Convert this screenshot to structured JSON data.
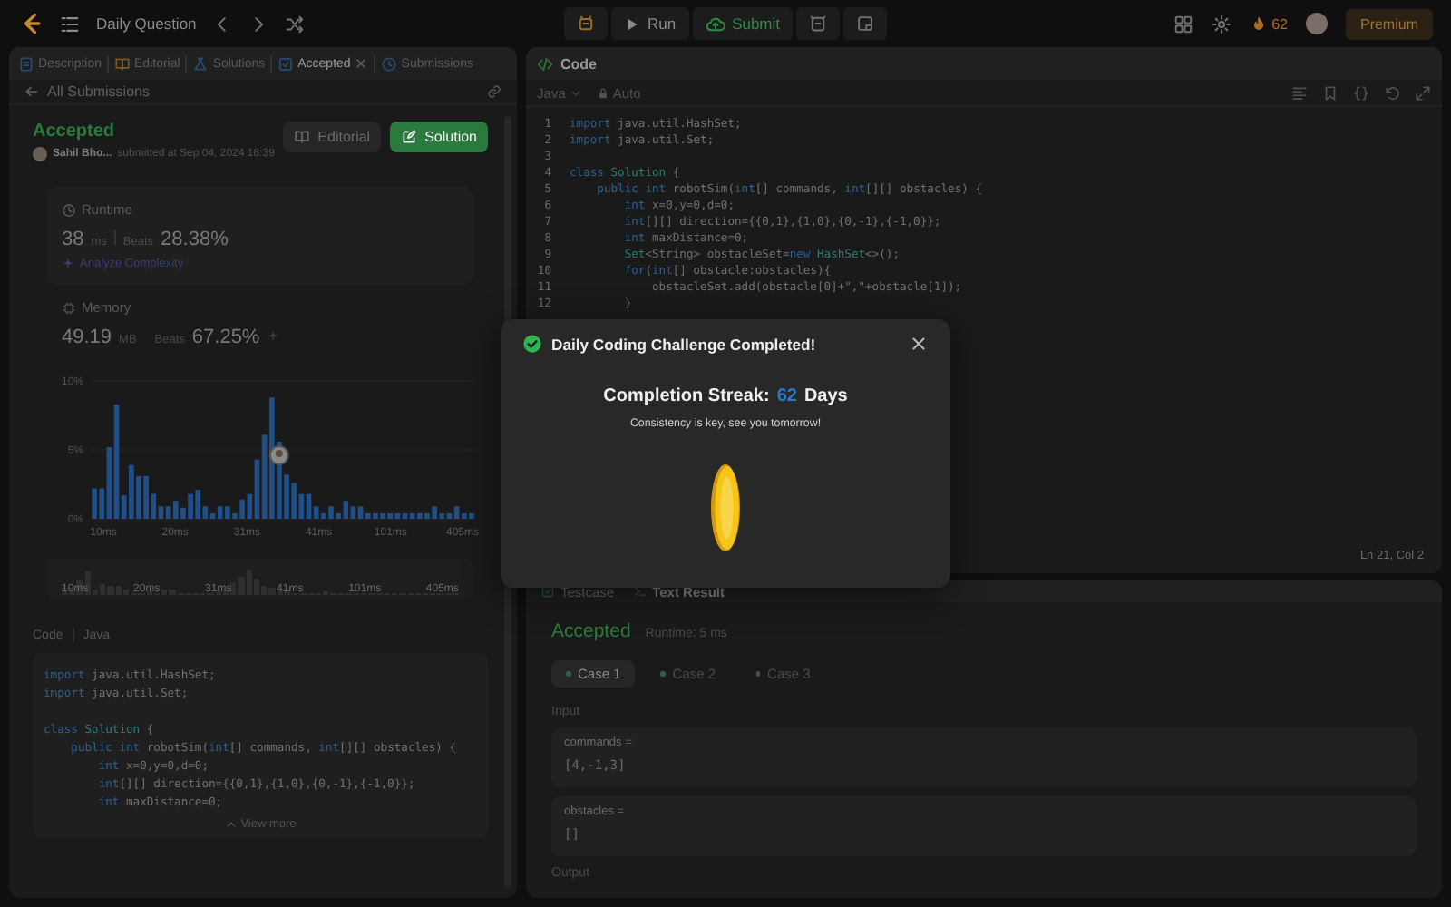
{
  "top_bar": {
    "title": "Daily Question",
    "run_label": "Run",
    "submit_label": "Submit",
    "streak_count": "62",
    "premium_label": "Premium"
  },
  "left_panel": {
    "tabs": [
      {
        "label": "Description",
        "selected": false,
        "closable": false
      },
      {
        "label": "Editorial",
        "selected": false,
        "closable": false
      },
      {
        "label": "Solutions",
        "selected": false,
        "closable": false
      },
      {
        "label": "Accepted",
        "selected": true,
        "closable": true
      },
      {
        "label": "Submissions",
        "selected": false,
        "closable": false
      }
    ],
    "back_label": "All Submissions",
    "submission": {
      "status": "Accepted",
      "user": "Sahil Bho...",
      "submitted": "submitted at Sep 04, 2024 18:39",
      "editorial_button": "Editorial",
      "solution_button": "Solution"
    },
    "runtime": {
      "title": "Runtime",
      "value": "38",
      "unit": "ms",
      "beats_label": "Beats",
      "beats": "28.38%",
      "analyze_link": "Analyze Complexity"
    },
    "memory": {
      "title": "Memory",
      "value": "49.19",
      "unit": "MB",
      "beats_label": "Beats",
      "beats": "67.25%"
    },
    "chart_data": {
      "type": "bar",
      "values": [
        2.2,
        2.2,
        5.2,
        8.3,
        1.7,
        3.9,
        3.1,
        3.1,
        1.8,
        0.9,
        0.9,
        1.3,
        0.8,
        1.8,
        2.1,
        0.9,
        0.4,
        0.9,
        0.9,
        0.4,
        1.4,
        1.8,
        4.3,
        6.1,
        8.8,
        5.6,
        3.2,
        2.6,
        1.8,
        1.8,
        0.9,
        0.4,
        0.9,
        0.4,
        1.3,
        0.9,
        0.9,
        0.4,
        0.4,
        0.4,
        0.4,
        0.4,
        0.4,
        0.4,
        0.4,
        0.4,
        0.9,
        0.4,
        0.4,
        0.9,
        0.4,
        0.4
      ],
      "ylim": [
        0,
        10
      ],
      "yticks": [
        {
          "value": 0,
          "label": "0%"
        },
        {
          "value": 5,
          "label": "5%"
        },
        {
          "value": 10,
          "label": "10%"
        }
      ]
    },
    "chart_axis_labels": [
      "10ms",
      "20ms",
      "31ms",
      "41ms",
      "101ms",
      "405ms"
    ],
    "overview_labels": [
      "10ms",
      "20ms",
      "31ms",
      "41ms",
      "101ms",
      "405ms"
    ],
    "code": {
      "label": "Code",
      "language": "Java",
      "view_more": "View more",
      "lines": [
        {
          "kind": "code",
          "tokens": [
            {
              "kind": "kw",
              "text": "import"
            },
            {
              "kind": "plain",
              "text": " java.util.HashSet;"
            }
          ]
        },
        {
          "kind": "code",
          "tokens": [
            {
              "kind": "kw",
              "text": "import"
            },
            {
              "kind": "plain",
              "text": " java.util.Set;"
            }
          ]
        },
        {
          "kind": "blank"
        },
        {
          "kind": "code",
          "tokens": [
            {
              "kind": "kw",
              "text": "class"
            },
            {
              "kind": "type",
              "text": " Solution"
            },
            {
              "kind": "plain",
              "text": " {"
            }
          ]
        },
        {
          "kind": "code",
          "tokens": [
            {
              "kind": "kw",
              "text": "    public int"
            },
            {
              "kind": "plain",
              "text": " robotSim("
            },
            {
              "kind": "kw",
              "text": "int"
            },
            {
              "kind": "plain",
              "text": "[] commands, "
            },
            {
              "kind": "kw",
              "text": "int"
            },
            {
              "kind": "plain",
              "text": "[][] obstacles) {"
            }
          ]
        },
        {
          "kind": "code",
          "tokens": [
            {
              "kind": "kw",
              "text": "        int"
            },
            {
              "kind": "plain",
              "text": " x=0,y=0,d=0;"
            }
          ]
        },
        {
          "kind": "code",
          "tokens": [
            {
              "kind": "kw",
              "text": "        int"
            },
            {
              "kind": "plain",
              "text": "[][] direction={{0,1},{1,0},{0,-1},{-1,0}};"
            }
          ]
        },
        {
          "kind": "code",
          "tokens": [
            {
              "kind": "kw",
              "text": "        int"
            },
            {
              "kind": "plain",
              "text": " maxDistance=0;"
            }
          ]
        }
      ]
    }
  },
  "code_panel": {
    "title": "Code",
    "language": "Java",
    "mode": "Auto",
    "cursor": "Ln 21, Col 2",
    "lines": [
      {
        "number": "1",
        "kind": "code",
        "tokens": [
          {
            "kind": "kw",
            "text": "import"
          },
          {
            "kind": "plain",
            "text": " java.util.HashSet;"
          }
        ]
      },
      {
        "number": "2",
        "kind": "code",
        "tokens": [
          {
            "kind": "kw",
            "text": "import"
          },
          {
            "kind": "plain",
            "text": " java.util.Set;"
          }
        ]
      },
      {
        "number": "3",
        "kind": "blank"
      },
      {
        "number": "4",
        "kind": "code",
        "tokens": [
          {
            "kind": "kw",
            "text": "class"
          },
          {
            "kind": "type",
            "text": " Solution"
          },
          {
            "kind": "plain",
            "text": " {"
          }
        ]
      },
      {
        "number": "5",
        "kind": "code",
        "tokens": [
          {
            "kind": "kw",
            "text": "    public int"
          },
          {
            "kind": "plain",
            "text": " robotSim("
          },
          {
            "kind": "kw",
            "text": "int"
          },
          {
            "kind": "plain",
            "text": "[] commands, "
          },
          {
            "kind": "kw",
            "text": "int"
          },
          {
            "kind": "plain",
            "text": "[][] obstacles) {"
          }
        ]
      },
      {
        "number": "6",
        "kind": "code",
        "tokens": [
          {
            "kind": "kw",
            "text": "        int"
          },
          {
            "kind": "plain",
            "text": " x=0,y=0,d=0;"
          }
        ]
      },
      {
        "number": "7",
        "kind": "code",
        "tokens": [
          {
            "kind": "kw",
            "text": "        int"
          },
          {
            "kind": "plain",
            "text": "[][] direction={{0,1},{1,0},{0,-1},{-1,0}};"
          }
        ]
      },
      {
        "number": "8",
        "kind": "code",
        "tokens": [
          {
            "kind": "kw",
            "text": "        int"
          },
          {
            "kind": "plain",
            "text": " maxDistance=0;"
          }
        ]
      },
      {
        "number": "9",
        "kind": "code",
        "tokens": [
          {
            "kind": "type",
            "text": "        Set"
          },
          {
            "kind": "plain",
            "text": "<String> obstacleSet="
          },
          {
            "kind": "kw",
            "text": "new"
          },
          {
            "kind": "type",
            "text": " HashSet"
          },
          {
            "kind": "plain",
            "text": "<>();"
          }
        ]
      },
      {
        "number": "10",
        "kind": "code",
        "tokens": [
          {
            "kind": "kw",
            "text": "        for"
          },
          {
            "kind": "plain",
            "text": "("
          },
          {
            "kind": "kw",
            "text": "int"
          },
          {
            "kind": "plain",
            "text": "[] obstacle:obstacles){"
          }
        ]
      },
      {
        "number": "11",
        "kind": "code",
        "tokens": [
          {
            "kind": "plain",
            "text": "            obstacleSet.add(obstacle[0]+\",\"+obstacle[1]);"
          }
        ]
      },
      {
        "number": "12",
        "kind": "code",
        "tokens": [
          {
            "kind": "plain",
            "text": "        }"
          }
        ]
      }
    ]
  },
  "result_panel": {
    "tabs": [
      {
        "label": "Testcase",
        "selected": false
      },
      {
        "label": "Text Result",
        "selected": true
      }
    ],
    "status": "Accepted",
    "runtime": "Runtime: 5 ms",
    "cases": [
      {
        "label": "Case 1",
        "selected": true
      },
      {
        "label": "Case 2",
        "selected": false
      },
      {
        "label": "Case 3",
        "selected": false
      }
    ],
    "input_label": "Input",
    "inputs": [
      {
        "name": "commands =",
        "value": "[4,-1,3]"
      },
      {
        "name": "obstacles =",
        "value": "[]"
      }
    ],
    "output_label": "Output"
  },
  "modal": {
    "title": "Daily Coding Challenge Completed!",
    "streak_label": "Completion Streak:",
    "streak_value": "62",
    "streak_unit": "Days",
    "message": "Consistency is key, see you tomorrow!"
  }
}
